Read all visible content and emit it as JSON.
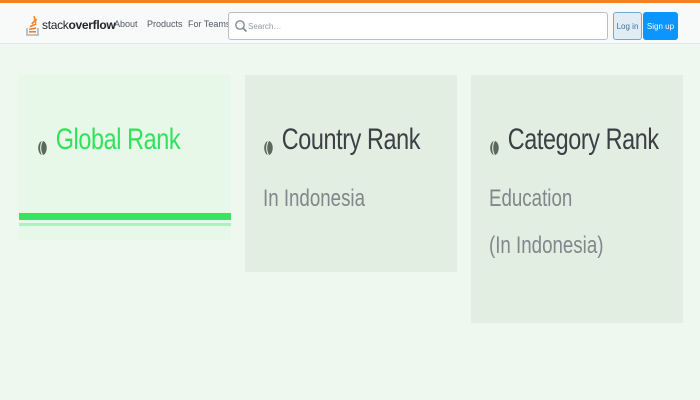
{
  "header": {
    "logo_light": "stack",
    "logo_bold": "overflow",
    "nav": [
      "About",
      "Products",
      "For Teams"
    ],
    "search_placeholder": "Search…",
    "login_label": "Log in",
    "signup_label": "Sign up",
    "accent_color": "#f48024"
  },
  "cards": [
    {
      "title": "Global Rank",
      "icon": "globe-icon",
      "lines": []
    },
    {
      "title": "Country Rank",
      "icon": "globe-icon",
      "lines": [
        "In Indonesia"
      ]
    },
    {
      "title": "Category Rank",
      "icon": "globe-icon",
      "lines": [
        "Education",
        "(In Indonesia)"
      ]
    }
  ]
}
